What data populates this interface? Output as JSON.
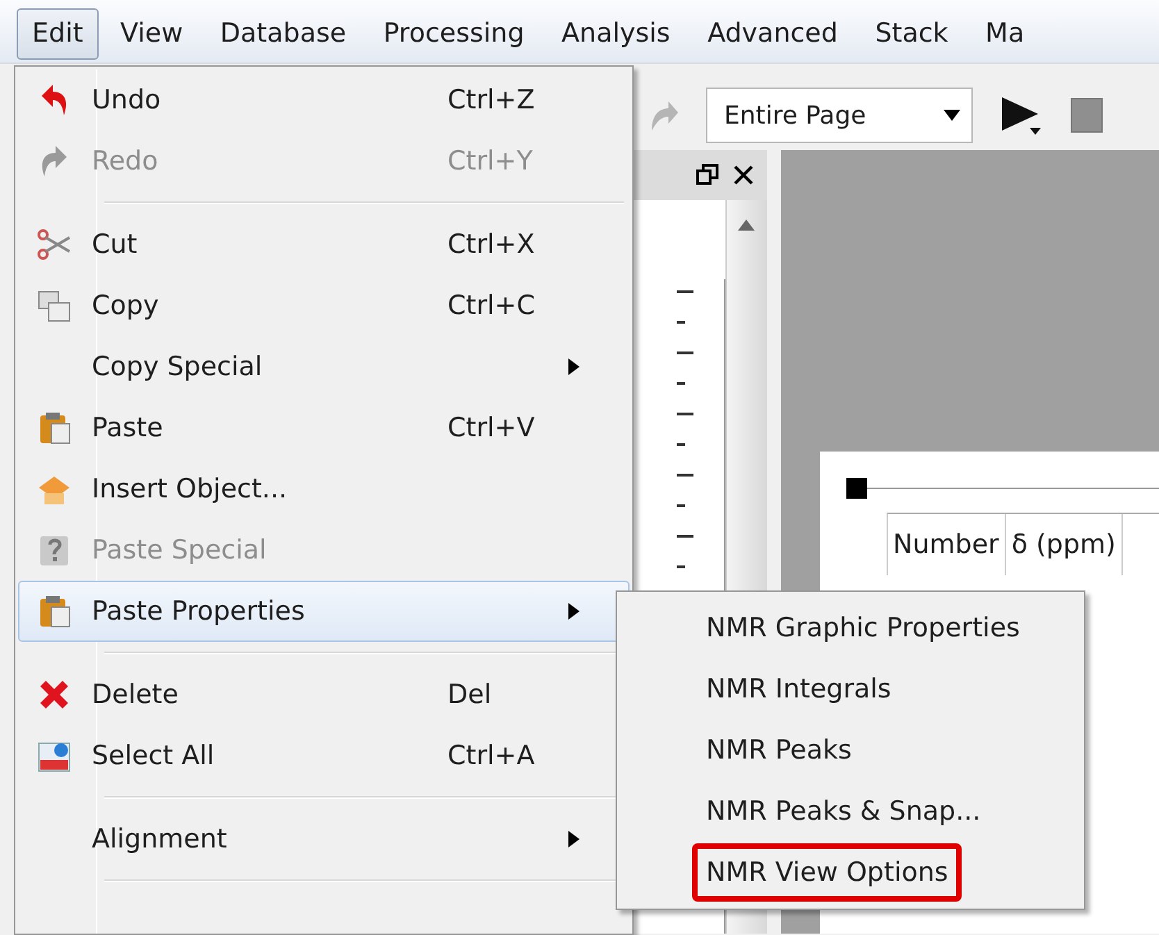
{
  "menubar": [
    {
      "label": "Edit",
      "selected": true
    },
    {
      "label": "View",
      "selected": false
    },
    {
      "label": "Database",
      "selected": false
    },
    {
      "label": "Processing",
      "selected": false
    },
    {
      "label": "Analysis",
      "selected": false
    },
    {
      "label": "Advanced",
      "selected": false
    },
    {
      "label": "Stack",
      "selected": false
    },
    {
      "label": "Ma",
      "selected": false
    }
  ],
  "toolbar": {
    "zoom_select": {
      "value": "Entire Page"
    }
  },
  "document": {
    "table": {
      "columns": [
        "Number",
        "δ (ppm)"
      ]
    }
  },
  "edit_menu": {
    "items": [
      {
        "kind": "item",
        "label": "Undo",
        "shortcut": "Ctrl+Z",
        "disabled": false,
        "highlighted": false,
        "submenu": false
      },
      {
        "kind": "item",
        "label": "Redo",
        "shortcut": "Ctrl+Y",
        "disabled": true,
        "highlighted": false,
        "submenu": false
      },
      {
        "kind": "separator"
      },
      {
        "kind": "item",
        "label": "Cut",
        "shortcut": "Ctrl+X",
        "disabled": false,
        "highlighted": false,
        "submenu": false
      },
      {
        "kind": "item",
        "label": "Copy",
        "shortcut": "Ctrl+C",
        "disabled": false,
        "highlighted": false,
        "submenu": false
      },
      {
        "kind": "item",
        "label": "Copy Special",
        "disabled": false,
        "highlighted": false,
        "submenu": true
      },
      {
        "kind": "item",
        "label": "Paste",
        "shortcut": "Ctrl+V",
        "disabled": false,
        "highlighted": false,
        "submenu": false
      },
      {
        "kind": "item",
        "label": "Insert Object...",
        "disabled": false,
        "highlighted": false,
        "submenu": false
      },
      {
        "kind": "item",
        "label": "Paste Special",
        "disabled": true,
        "highlighted": false,
        "submenu": false
      },
      {
        "kind": "item",
        "label": "Paste Properties",
        "disabled": false,
        "highlighted": true,
        "submenu": true
      },
      {
        "kind": "separator"
      },
      {
        "kind": "item",
        "label": "Delete",
        "shortcut": "Del",
        "disabled": false,
        "highlighted": false,
        "submenu": false
      },
      {
        "kind": "item",
        "label": "Select All",
        "shortcut": "Ctrl+A",
        "disabled": false,
        "highlighted": false,
        "submenu": false
      },
      {
        "kind": "separator"
      },
      {
        "kind": "item",
        "label": "Alignment",
        "disabled": false,
        "highlighted": false,
        "submenu": true
      },
      {
        "kind": "separator"
      }
    ]
  },
  "submenu": {
    "items": [
      {
        "label": "NMR Graphic Properties",
        "annotated": false
      },
      {
        "label": "NMR Integrals",
        "annotated": false
      },
      {
        "label": "NMR Peaks",
        "annotated": false
      },
      {
        "label": "NMR Peaks & Snap...",
        "annotated": false
      },
      {
        "label": "NMR View Options",
        "annotated": true
      }
    ]
  }
}
